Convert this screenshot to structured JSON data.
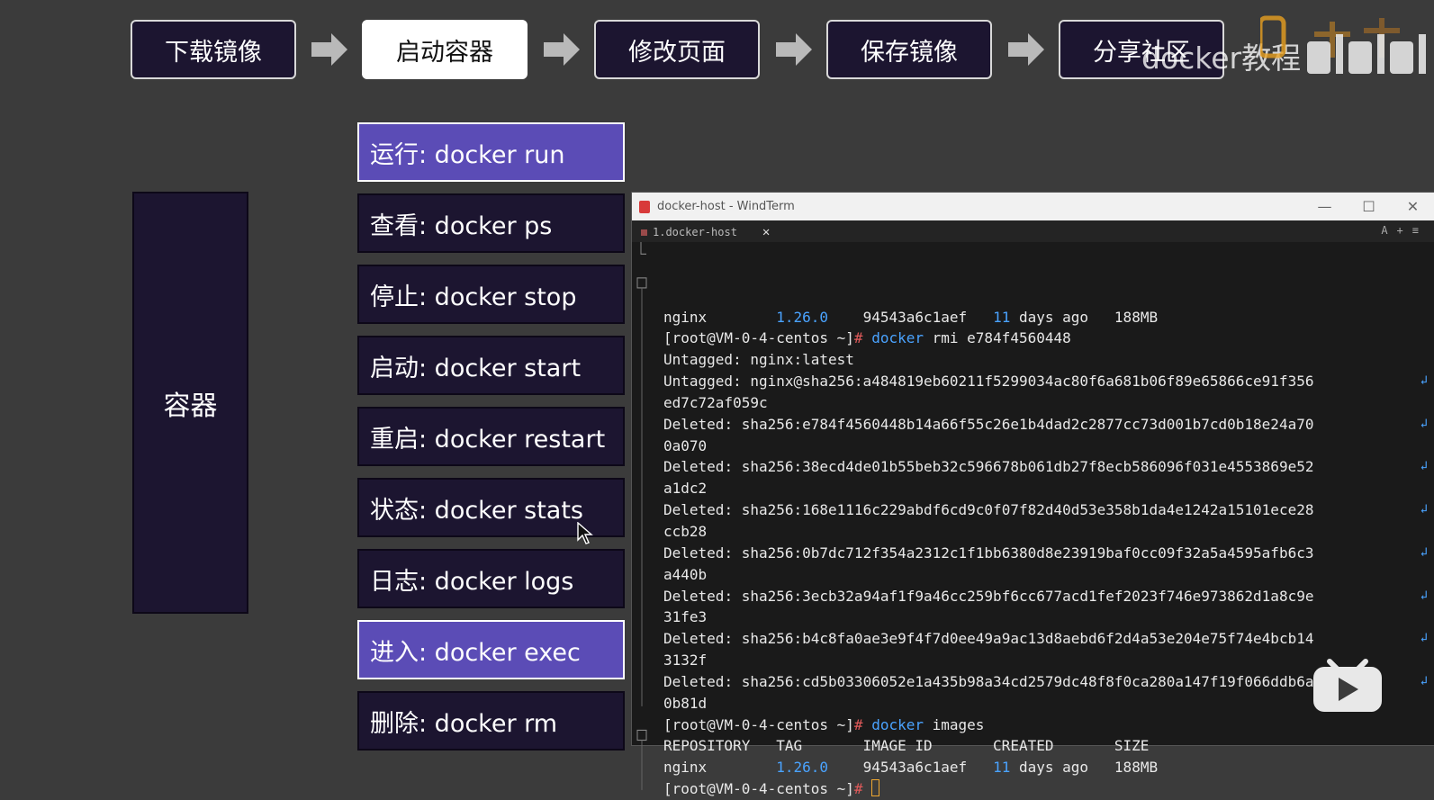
{
  "steps": [
    "下载镜像",
    "启动容器",
    "修改页面",
    "保存镜像",
    "分享社区"
  ],
  "container_label": "容器",
  "commands": [
    "运行:  docker run",
    "查看:  docker ps",
    "停止:  docker stop",
    "启动:  docker start",
    "重启:  docker restart",
    "状态:  docker stats",
    "日志:  docker logs",
    "进入:  docker exec",
    "删除:  docker rm"
  ],
  "watermark": "docker教程",
  "terminal": {
    "title": "docker-host - WindTerm",
    "tab": "1.docker-host",
    "prompt": "[root@VM-0-4-centos ~]#",
    "lines": [
      {
        "a": "nginx        ",
        "b": "1.26.0",
        "c": "    94543a6c1aef   ",
        "d": "11",
        "e": " days ago   188MB"
      },
      {
        "cmd": "docker",
        "rest": " rmi e784f4560448"
      },
      {
        "k": "Untagged",
        "v": "nginx",
        "v2": ":latest"
      },
      {
        "k": "Untagged",
        "v": "nginx@sha256",
        "v2": ":a484819eb60211f5299034ac80f6a681b06f89e65866ce91f356",
        "wrap": "ed7c72af059c"
      },
      {
        "k": "Deleted",
        "v": "sha256",
        "v2": ":e784f4560448b14a66f55c26e1b4dad2c2877cc73d001b7cd0b18e24a70",
        "wrap": "0a070"
      },
      {
        "k": "Deleted",
        "v": "sha256",
        "v2": ":38ecd4de01b55beb32c596678b061db27f8ecb586096f031e4553869e52",
        "wrap": "a1dc2"
      },
      {
        "k": "Deleted",
        "v": "sha256",
        "v2": ":168e1116c229abdf6cd9c0f07f82d40d53e358b1da4e1242a15101ece28",
        "wrap": "ccb28"
      },
      {
        "k": "Deleted",
        "v": "sha256",
        "v2": ":0b7dc712f354a2312c1f1bb6380d8e23919baf0cc09f32a5a4595afb6c3",
        "wrap": "a440b"
      },
      {
        "k": "Deleted",
        "v": "sha256",
        "v2": ":3ecb32a94af1f9a46cc259bf6cc677acd1fef2023f746e973862d1a8c9e",
        "wrap": "31fe3"
      },
      {
        "k": "Deleted",
        "v": "sha256",
        "v2": ":b4c8fa0ae3e9f4f7d0ee49a9ac13d8aebd6f2d4a53e204e75f74e4bcb14",
        "wrap": "3132f"
      },
      {
        "k": "Deleted",
        "v": "sha256",
        "v2": ":cd5b03306052e1a435b98a34cd2579dc48f8f0ca280a147f19f066ddb6a",
        "wrap": "0b81d"
      },
      {
        "cmd": "docker",
        "rest": " images"
      },
      {
        "hdr": "REPOSITORY   TAG       IMAGE ID       CREATED       SIZE"
      },
      {
        "a": "nginx        ",
        "b": "1.26.0",
        "c": "    94543a6c1aef   ",
        "d": "11",
        "e": " days ago   188MB"
      },
      {
        "final": true
      }
    ]
  },
  "colors": {
    "accent": "#5b4cb6",
    "dark_box": "#1c1530",
    "term_blue": "#4aa3ff",
    "prompt_red": "#e05a5a"
  }
}
